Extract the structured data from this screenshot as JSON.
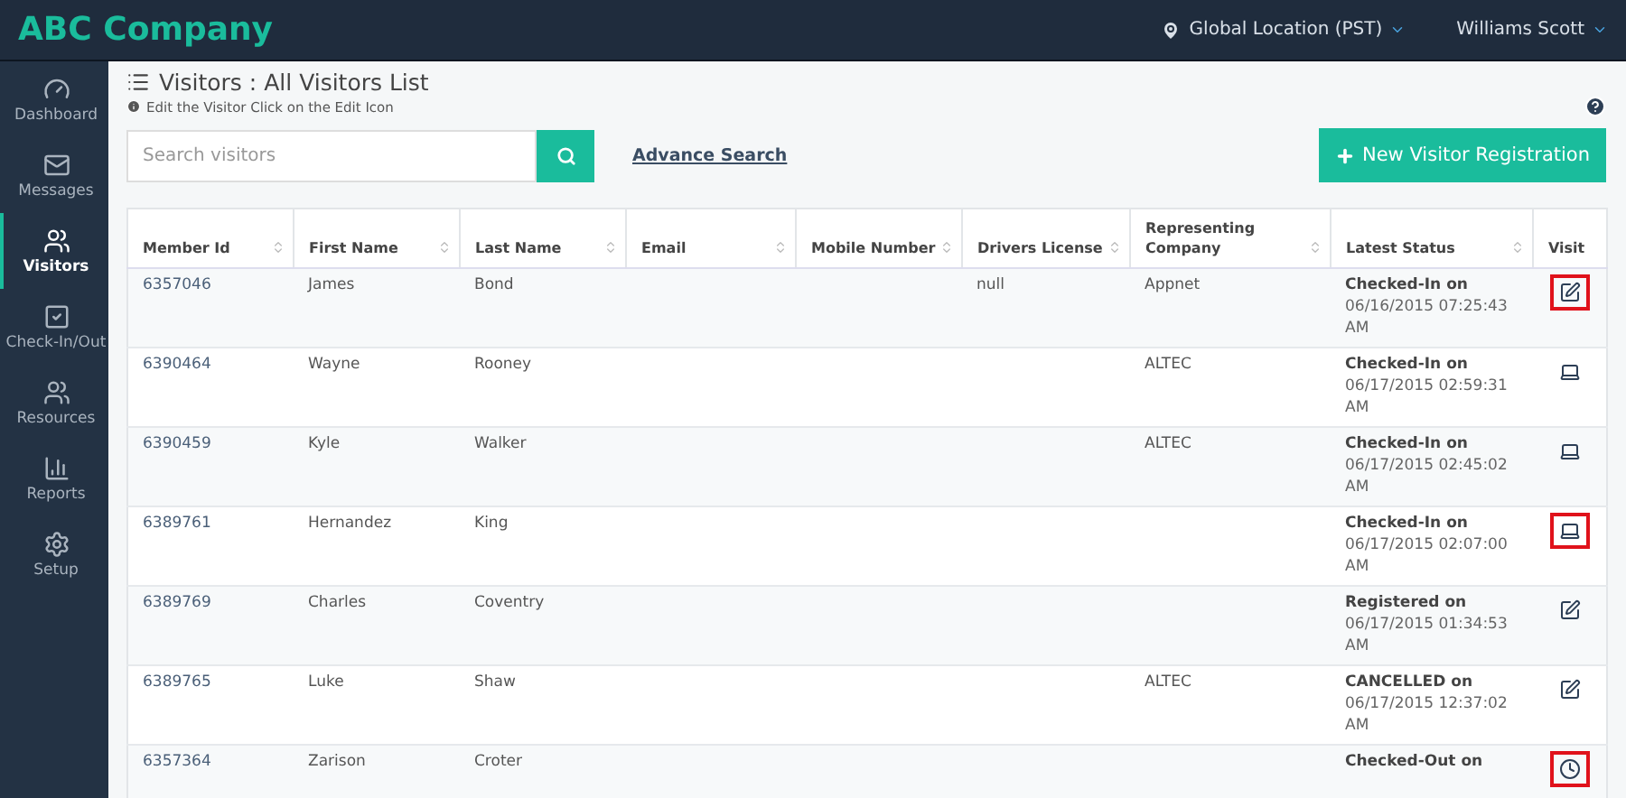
{
  "header": {
    "brand": "ABC Company",
    "location": "Global Location (PST)",
    "user": "Williams Scott"
  },
  "sidebar": {
    "items": [
      {
        "label": "Dashboard",
        "selected": false
      },
      {
        "label": "Messages",
        "selected": false
      },
      {
        "label": "Visitors",
        "selected": true
      },
      {
        "label": "Check-In/Out",
        "selected": false
      },
      {
        "label": "Resources",
        "selected": false
      },
      {
        "label": "Reports",
        "selected": false
      },
      {
        "label": "Setup",
        "selected": false
      }
    ]
  },
  "page": {
    "title": "Visitors : All Visitors List",
    "hint": "Edit the Visitor Click on the Edit Icon"
  },
  "search": {
    "placeholder": "Search visitors",
    "advanced_link": "Advance Search"
  },
  "new_button": "New Visitor Registration",
  "table": {
    "columns": [
      {
        "label": "Member Id",
        "sortable": true
      },
      {
        "label": "First Name",
        "sortable": true
      },
      {
        "label": "Last Name",
        "sortable": true
      },
      {
        "label": "Email",
        "sortable": true
      },
      {
        "label": "Mobile Number",
        "sortable": true
      },
      {
        "label": "Drivers License",
        "sortable": true
      },
      {
        "label": "Representing Company",
        "sortable": true
      },
      {
        "label": "Latest Status",
        "sortable": true
      },
      {
        "label": "Visit",
        "sortable": false
      }
    ],
    "rows": [
      {
        "member_id": "6357046",
        "first_name": "James",
        "last_name": "Bond",
        "drivers_license": "null",
        "company": "Appnet",
        "status": "Checked-In on",
        "status_time": [
          "06/16/2015 07:25:43",
          "AM"
        ],
        "kind": "edit",
        "highlighted": true
      },
      {
        "member_id": "6390464",
        "first_name": "Wayne",
        "last_name": "Rooney",
        "company": "ALTEC",
        "status": "Checked-In on",
        "status_time": [
          "06/17/2015 02:59:31",
          "AM"
        ],
        "kind": "laptop",
        "highlighted": false
      },
      {
        "member_id": "6390459",
        "first_name": "Kyle",
        "last_name": "Walker",
        "company": "ALTEC",
        "status": "Checked-In on",
        "status_time": [
          "06/17/2015 02:45:02",
          "AM"
        ],
        "kind": "laptop",
        "highlighted": false
      },
      {
        "member_id": "6389761",
        "first_name": "Hernandez",
        "last_name": "King",
        "status": "Checked-In on",
        "status_time": [
          "06/17/2015 02:07:00",
          "AM"
        ],
        "kind": "laptop",
        "highlighted": true
      },
      {
        "member_id": "6389769",
        "first_name": "Charles",
        "last_name": "Coventry",
        "status": "Registered on",
        "status_time": [
          "06/17/2015 01:34:53",
          "AM"
        ],
        "kind": "edit",
        "highlighted": false
      },
      {
        "member_id": "6389765",
        "first_name": "Luke",
        "last_name": "Shaw",
        "company": "ALTEC",
        "status": "CANCELLED on",
        "status_time": [
          "06/17/2015 12:37:02",
          "AM"
        ],
        "kind": "edit",
        "highlighted": false
      },
      {
        "member_id": "6357364",
        "first_name": "Zarison",
        "last_name": "Croter",
        "status": "Checked-Out on",
        "kind": "clock",
        "highlighted": true
      }
    ]
  }
}
